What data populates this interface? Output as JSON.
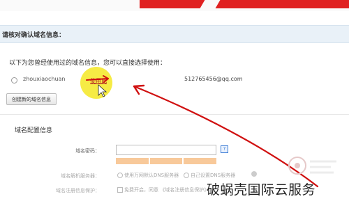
{
  "header": {
    "confirm_title": "请核对确认域名信息："
  },
  "used_domains": {
    "title": "以下为您曾经使用过的域名信息，您可以直接选择使用：",
    "contacts": [
      {
        "name": "zhouxiaochuan",
        "action": "使用此",
        "email": "512765456@qq.com"
      }
    ]
  },
  "create_button_label": "创建新的域名信息",
  "config": {
    "title": "域名配置信息",
    "password_label": "域名密码：",
    "dns_label": "域名解析服务器：",
    "dns_option1": "使用万网默认DNS服务器",
    "dns_option2": "自己设置DNS服务器",
    "privacy_label": "域名注册信息保护：",
    "privacy_option": "免费开启，同意 《域名注册信息保护》"
  },
  "watermark": {
    "text": "破蜗壳国际云服务"
  },
  "colors": {
    "brand_red": "#e02020",
    "highlight": "#f5ea3b",
    "annotation": "#d01010"
  }
}
